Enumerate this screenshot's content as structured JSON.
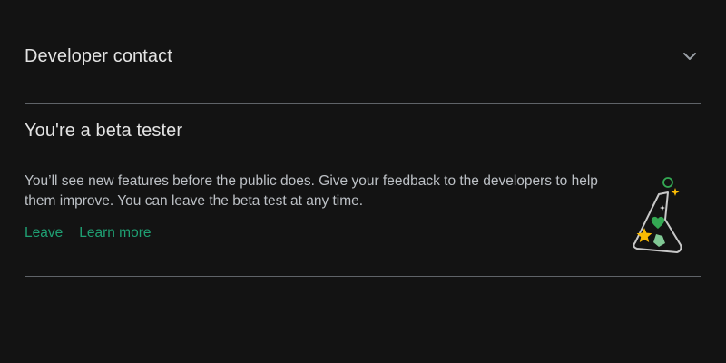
{
  "developer_contact": {
    "title": "Developer contact",
    "expand_icon": "chevron-down-icon"
  },
  "beta": {
    "title": "You're a beta tester",
    "body": "You’ll see new features before the public does. Give your feedback to the developers to help them improve. You can leave the beta test at any time.",
    "leave_label": "Leave",
    "learn_more_label": "Learn more",
    "illustration_icon": "beta-flask-icon"
  },
  "colors": {
    "background": "#131313",
    "text_primary": "#e3e3e3",
    "text_secondary": "#bdc1c6",
    "link": "#1fa073",
    "divider": "#5f6368"
  }
}
